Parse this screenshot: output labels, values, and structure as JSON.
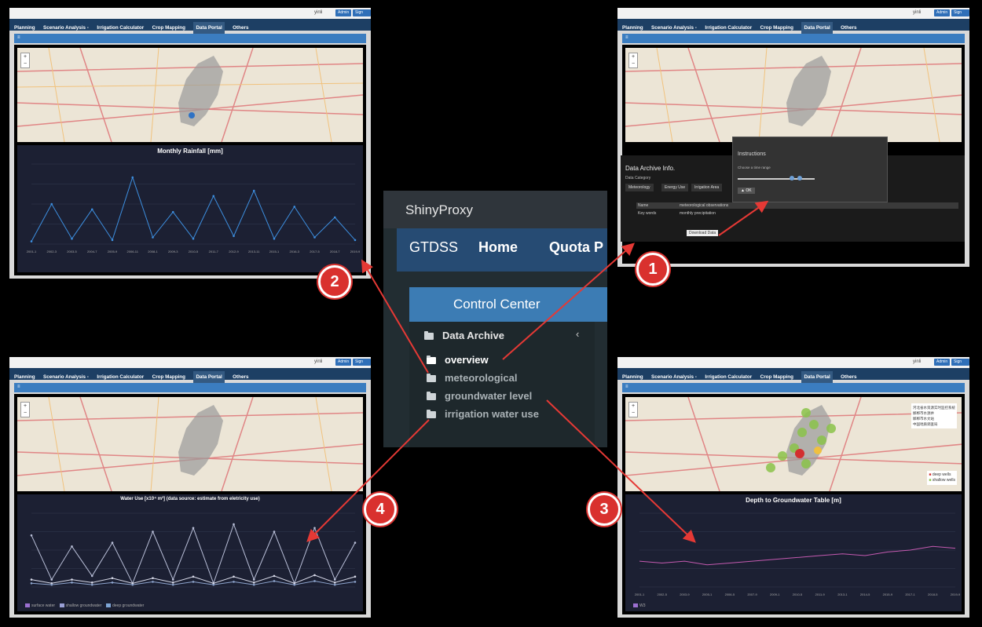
{
  "app": {
    "user": "yinli",
    "admin_label": "Admin",
    "signout_label": "Sign Out",
    "nav": [
      "Planning",
      "Scenario Analysis -",
      "Irrigation Calculator",
      "Crop Mapping",
      "Data Portal",
      "Others"
    ],
    "active_tab": "Data Portal",
    "menu_icon": "bars-icon"
  },
  "center": {
    "brand": "ShinyProxy",
    "nav_gtdss": "GTDSS",
    "nav_home": "Home",
    "nav_quota": "Quota P",
    "control_center": "Control Center",
    "data_archive": "Data Archive",
    "items": [
      "overview",
      "meteorological",
      "groundwater level",
      "irrigation water use"
    ]
  },
  "panels": {
    "top_left": {
      "chart_title": "Monthly Rainfall [mm]"
    },
    "top_right": {
      "archive_title": "Data Archive Info.",
      "data_category": "Data Category",
      "categories": [
        "Meteorology",
        "Energy Use",
        "Irrigation Area"
      ],
      "dialog_title": "Instructions",
      "dialog_text": "Choose a time range",
      "ok_label": "OK",
      "table": [
        [
          "Name",
          "meteorological observations"
        ],
        [
          "Key words",
          "monthly precipitation"
        ]
      ],
      "download": "Download Data"
    },
    "bottom_left": {
      "chart_title": "Water Use [x10⁴ m³] (data source: estimate from eletricity use)",
      "legend": [
        "surface water",
        "shallow groundwater",
        "deep groundwater"
      ]
    },
    "bottom_right": {
      "chart_title": "Depth to Groundwater Table [m]",
      "legend_series": "W3",
      "map_legend": [
        "deep wells",
        "shallow wells"
      ],
      "layers": [
        "河北省水资源实时监控系统",
        "邯郸市水源井",
        "邯郸市水文站",
        "中国地质调查局"
      ]
    }
  },
  "badges": [
    "1",
    "2",
    "3",
    "4"
  ],
  "chart_data": [
    {
      "type": "line",
      "title": "Monthly Rainfall [mm]",
      "x": [
        "2001-1",
        "2002-3",
        "2003-5",
        "2004-7",
        "2005-9",
        "2006-11",
        "2008-1",
        "2009-3",
        "2010-5",
        "2011-7",
        "2012-9",
        "2013-11",
        "2015-1",
        "2016-3",
        "2017-5",
        "2018-7",
        "2019-9"
      ],
      "series": [
        {
          "values": [
            10,
            150,
            20,
            130,
            15,
            250,
            25,
            120,
            20,
            180,
            30,
            200,
            20,
            140,
            25,
            100,
            15
          ]
        }
      ]
    },
    {
      "type": "line",
      "title": "Depth to Groundwater Table [m]",
      "x": [
        "2001-1",
        "2002-5",
        "2003-9",
        "2005-1",
        "2006-5",
        "2007-9",
        "2009-1",
        "2010-5",
        "2011-9",
        "2013-1",
        "2014-5",
        "2015-9",
        "2017-1",
        "2018-5",
        "2019-9"
      ],
      "series": [
        {
          "name": "W3",
          "values": [
            14,
            13,
            14,
            12,
            13,
            14,
            15,
            16,
            17,
            18,
            17,
            19,
            20,
            22,
            21
          ]
        }
      ]
    },
    {
      "type": "line",
      "title": "Water Use [x10⁴ m³] (data source: estimate from eletricity use)",
      "series": [
        {
          "name": "surface water",
          "values": [
            70,
            10,
            55,
            15,
            60,
            5,
            75,
            10,
            80,
            5,
            85,
            10,
            75,
            5,
            80,
            10,
            60
          ]
        },
        {
          "name": "shallow groundwater",
          "values": [
            10,
            5,
            10,
            6,
            12,
            5,
            12,
            6,
            14,
            5,
            14,
            6,
            15,
            5,
            16,
            6,
            14
          ]
        },
        {
          "name": "deep groundwater",
          "values": [
            5,
            3,
            6,
            3,
            6,
            3,
            7,
            3,
            7,
            3,
            7,
            3,
            8,
            3,
            8,
            3,
            7
          ]
        }
      ]
    }
  ]
}
